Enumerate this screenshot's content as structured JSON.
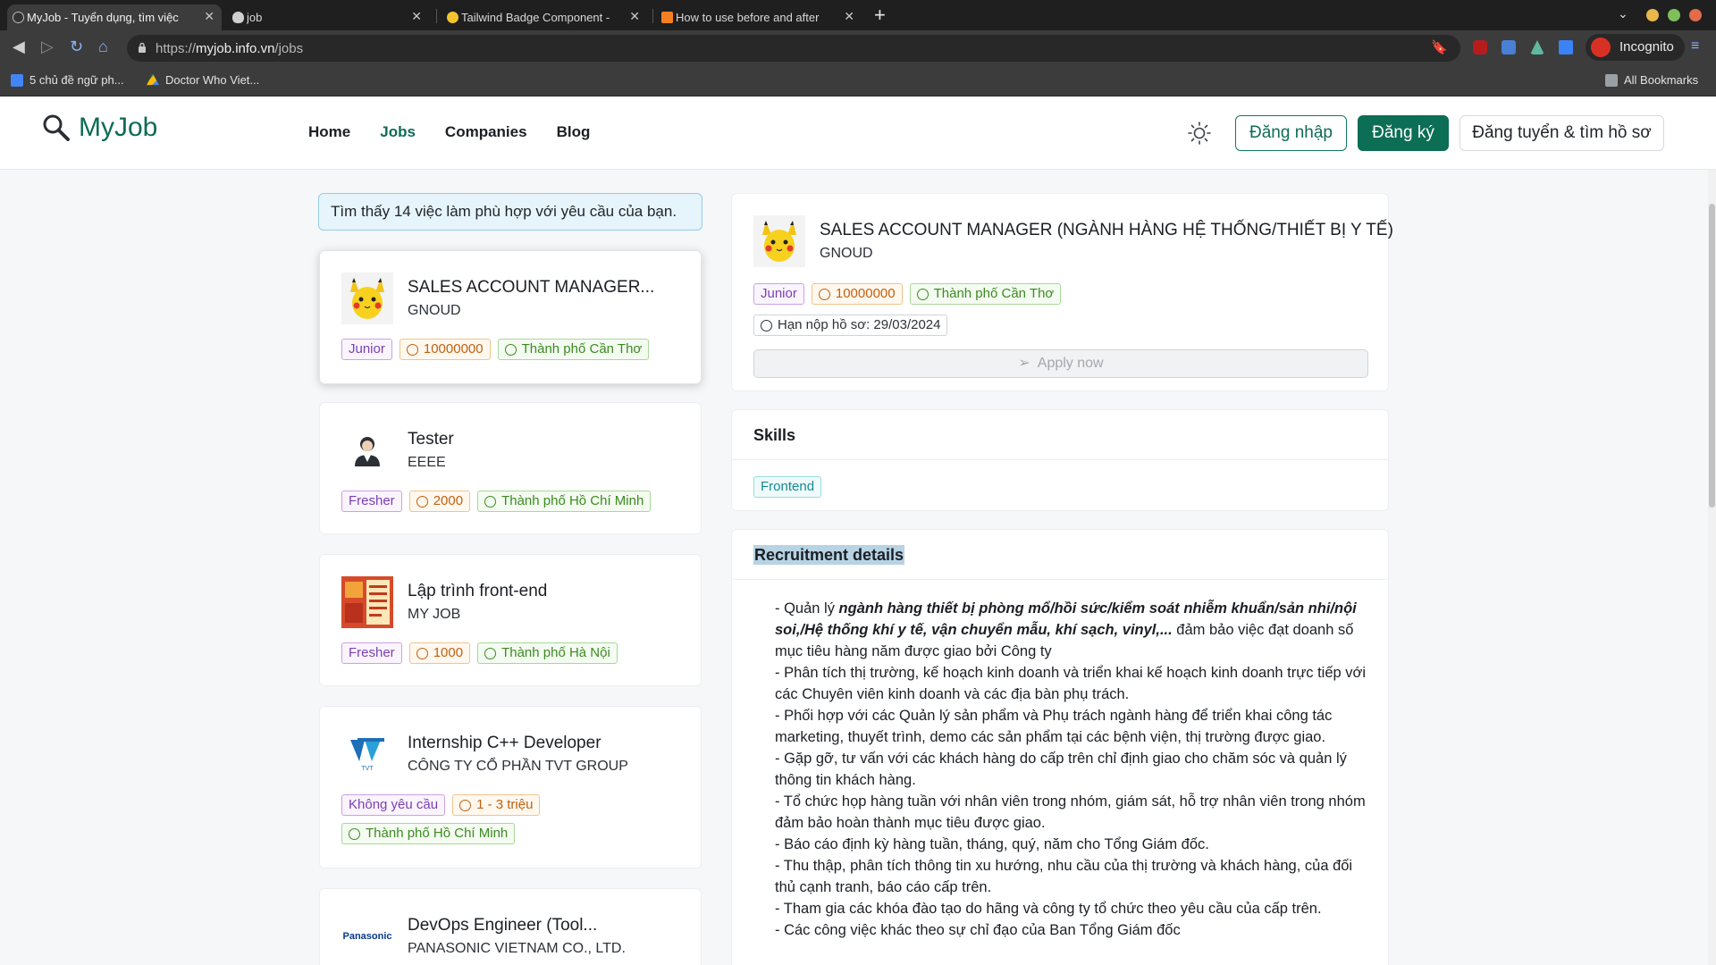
{
  "browser": {
    "tabs": [
      {
        "title": "MyJob - Tuyển dụng, tìm việc"
      },
      {
        "title": "job"
      },
      {
        "title": "Tailwind Badge Component -"
      },
      {
        "title": "How to use before and after"
      }
    ],
    "url_prefix": "https://",
    "url_host": "myjob.info.vn",
    "url_path": "/jobs",
    "incognito_label": "Incognito",
    "bookmarks": [
      {
        "label": "5 chủ đề ngữ ph..."
      },
      {
        "label": "Doctor Who Viet..."
      }
    ],
    "all_bookmarks_label": "All Bookmarks"
  },
  "site": {
    "logo_text": "MyJob",
    "nav": [
      {
        "label": "Home"
      },
      {
        "label": "Jobs"
      },
      {
        "label": "Companies"
      },
      {
        "label": "Blog"
      }
    ],
    "active_nav": "Jobs",
    "login_label": "Đăng nhập",
    "register_label": "Đăng ký",
    "employer_label": "Đăng tuyển & tìm hồ sơ",
    "brand_color": "#0b6e55"
  },
  "job_list": {
    "result_text": "Tìm thấy 14 việc làm phù hợp với yêu cầu của bạn.",
    "jobs": [
      {
        "title": "SALES ACCOUNT MANAGER...",
        "company": "GNOUD",
        "level": "Junior",
        "salary": "10000000",
        "location": "Thành phố Cần Thơ",
        "logo": "pikachu-logo"
      },
      {
        "title": "Tester",
        "company": "EEEE",
        "level": "Fresher",
        "salary": "2000",
        "location": "Thành phố Hồ Chí Minh",
        "logo": "person-logo"
      },
      {
        "title": "Lập trình front-end",
        "company": "MY JOB",
        "level": "Fresher",
        "salary": "1000",
        "location": "Thành phố Hà Nội",
        "logo": "document-logo"
      },
      {
        "title": "Internship C++ Developer",
        "company": "CÔNG TY CỔ PHẦN TVT GROUP",
        "level": "Không yêu cầu",
        "salary": "1 - 3 triệu",
        "location": "Thành phố Hồ Chí Minh",
        "logo": "tvt-logo",
        "logo_text": "TVT"
      },
      {
        "title": "DevOps Engineer (Tool...",
        "company": "PANASONIC VIETNAM CO., LTD.",
        "logo": "panasonic-logo",
        "logo_text": "Panasonic"
      }
    ]
  },
  "detail": {
    "title": "SALES ACCOUNT MANAGER (NGÀNH HÀNG HỆ THỐNG/THIẾT BỊ Y TẾ)",
    "company": "GNOUD",
    "level": "Junior",
    "salary": "10000000",
    "location": "Thành phố Cần Thơ",
    "deadline": "Hạn nộp hồ sơ: 29/03/2024",
    "apply_label": "Apply now",
    "skills_heading": "Skills",
    "skills": [
      "Frontend"
    ],
    "recruitment_heading": "Recruitment details",
    "desc": {
      "p1_prefix": "- Quản lý ",
      "p1_bold": "ngành hàng thiết bị phòng mổ/hồi sức/kiểm soát nhiễm khuẩn/sản nhi/nội soi,/Hệ thống khí y tế, vận chuyển mẫu, khí sạch, vinyl,...",
      "p1_suffix": " đảm bảo việc đạt doanh số mục tiêu hàng năm được giao bởi Công ty",
      "lines": [
        "- Phân tích thị trường, kế hoạch kinh doanh và triển khai kế hoạch kinh doanh trực tiếp với các Chuyên viên kinh doanh và các địa bàn phụ trách.",
        "- Phối hợp với các Quản lý sản phẩm và Phụ trách ngành hàng để triển khai công tác marketing, thuyết trình, demo các sản phẩm tại các bệnh viện, thị trường được giao.",
        "- Gặp gỡ, tư vấn với các khách hàng do cấp trên chỉ định giao cho chăm sóc và quản lý thông tin khách hàng.",
        "- Tổ chức họp hàng tuần với nhân viên trong nhóm, giám sát, hỗ trợ nhân viên trong nhóm đảm bảo hoàn thành mục tiêu được giao.",
        "- Báo cáo định kỳ hàng tuần, tháng, quý, năm cho Tổng Giám đốc.",
        "- Thu thập, phân tích thông tin xu hướng, nhu cầu của thị trường và khách hàng, của đối thủ cạnh tranh, báo cáo cấp trên.",
        "- Tham gia các khóa đào tạo do hãng và công ty tổ chức theo yêu cầu của cấp trên.",
        "- Các công việc khác theo sự chỉ đạo của Ban Tổng Giám đốc"
      ]
    }
  }
}
